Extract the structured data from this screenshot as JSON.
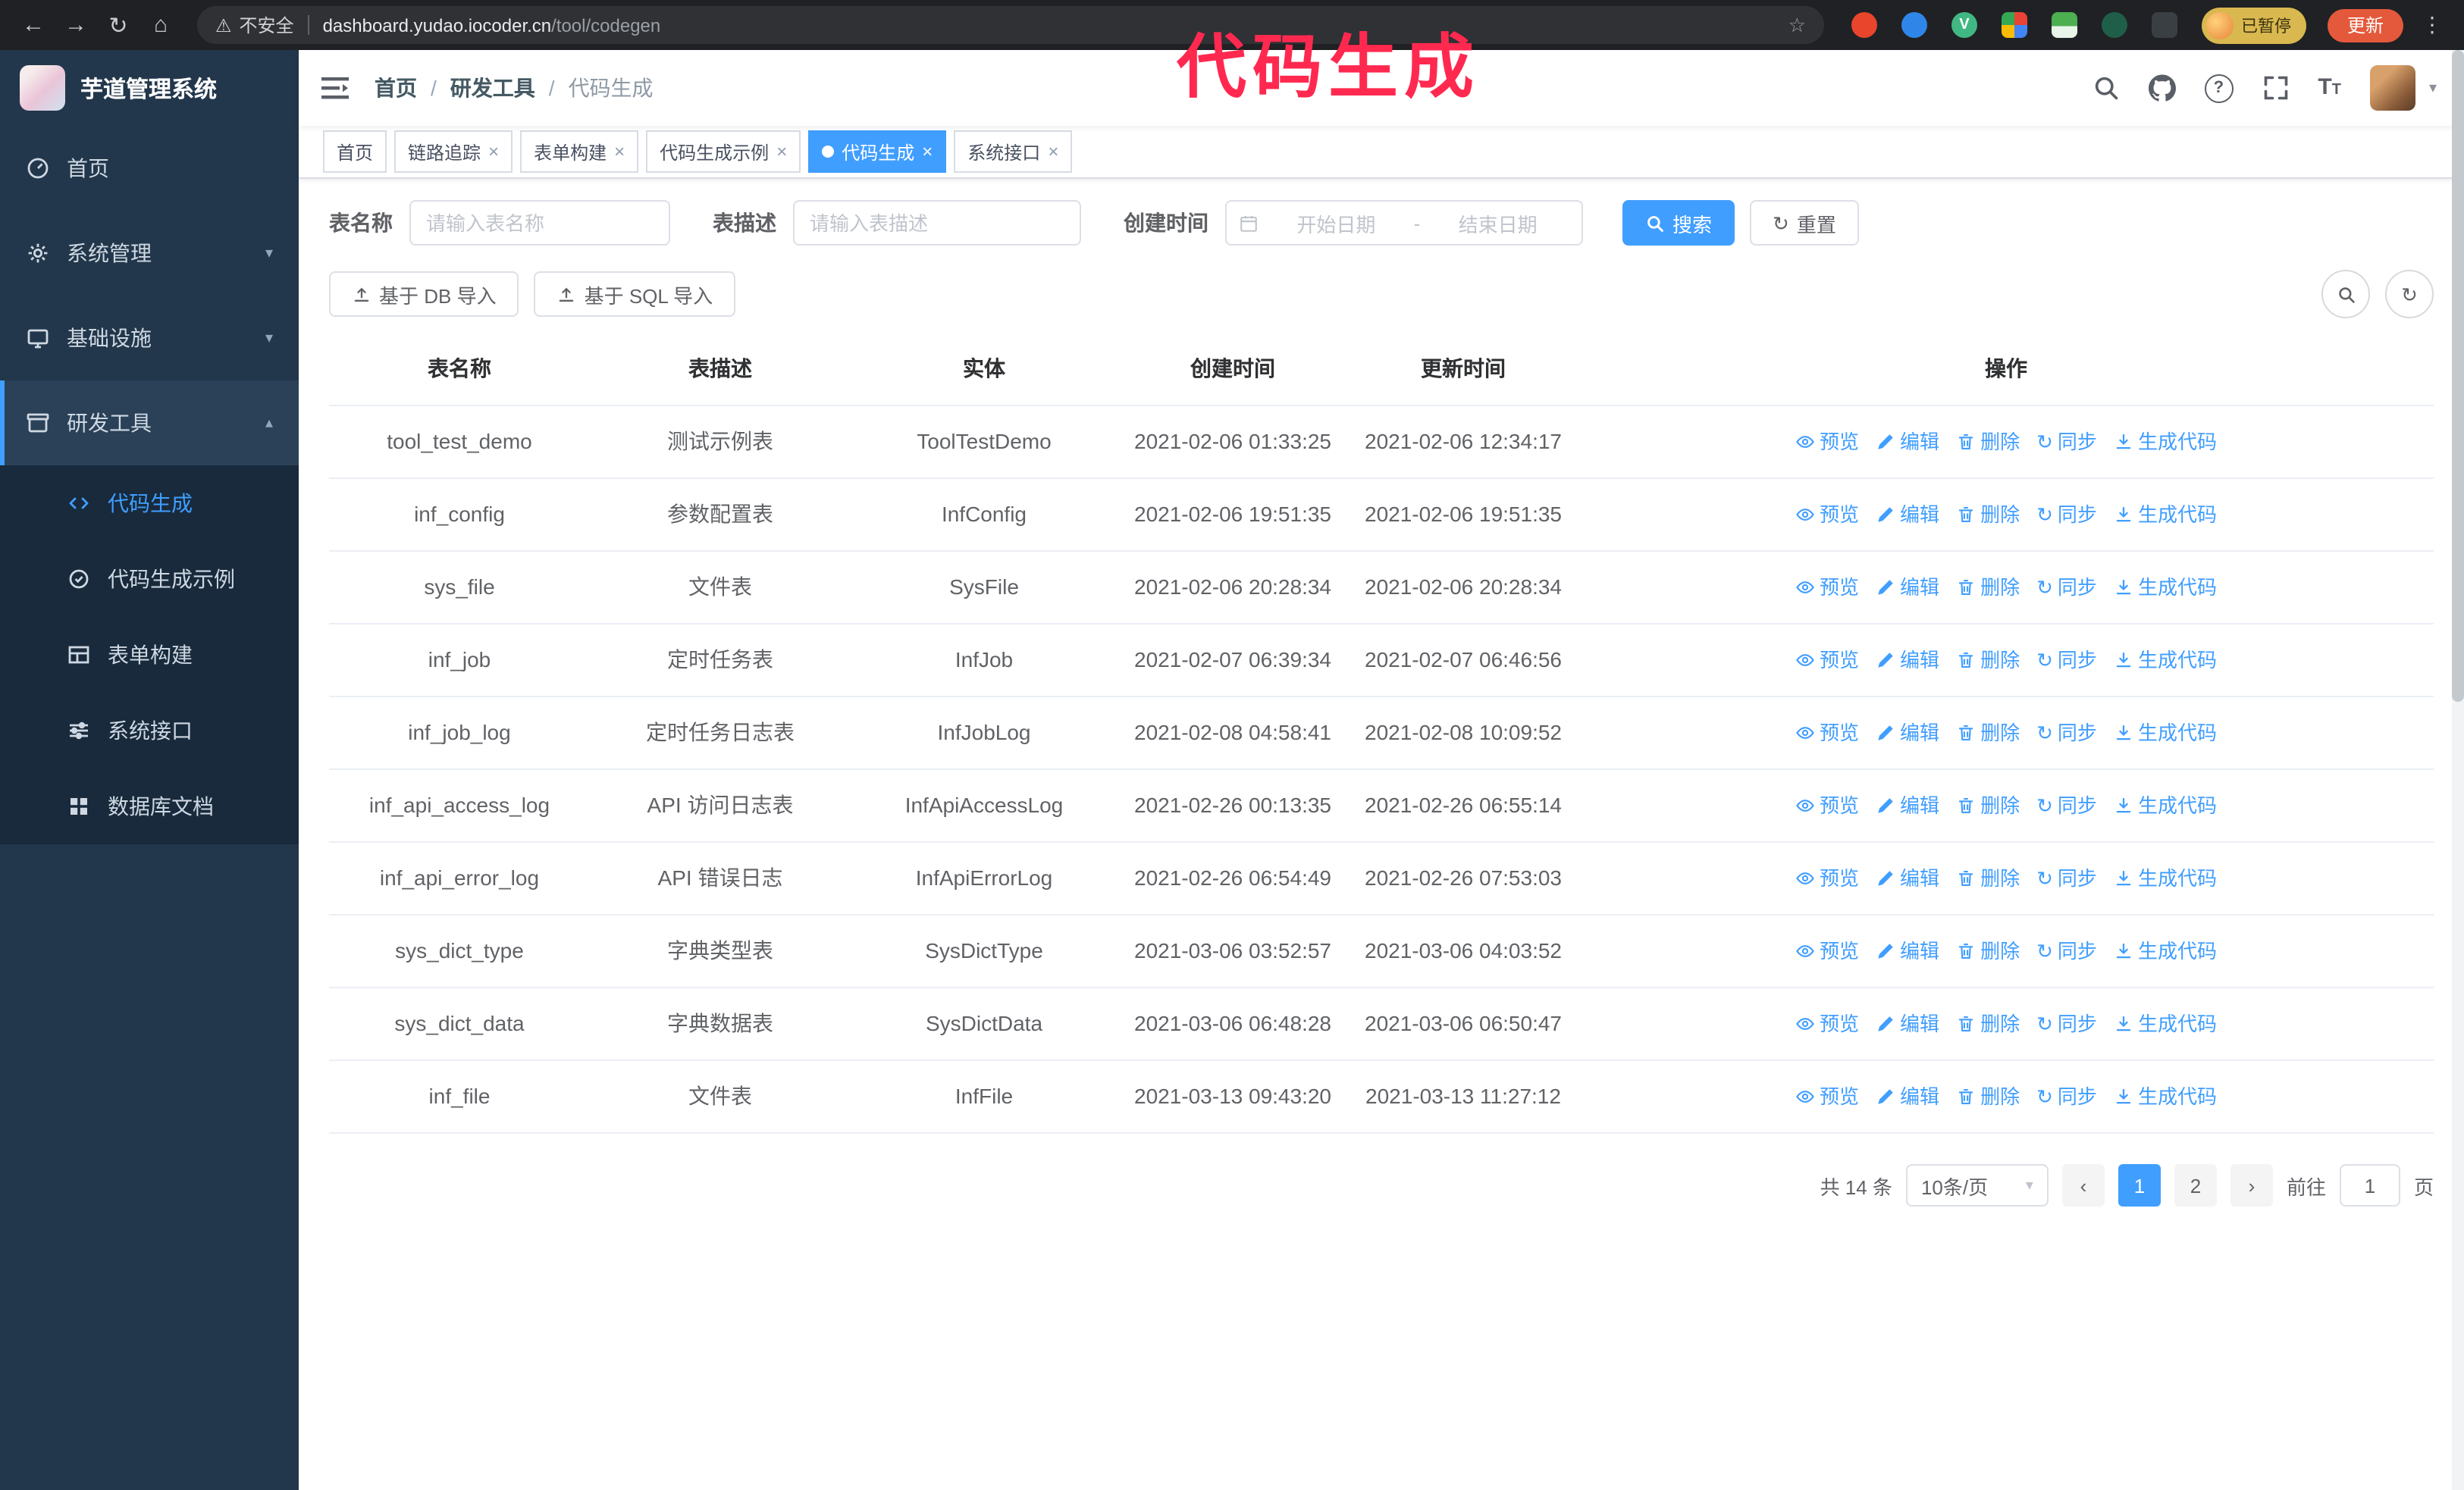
{
  "annotation": {
    "text": "代码生成",
    "color": "#ff2950"
  },
  "glyphs": {
    "back": "←",
    "forward": "→",
    "reload": "↻",
    "home": "⌂",
    "warning": "⚠",
    "star": "☆",
    "more": "⋮",
    "vue": "V",
    "close": "×",
    "chevron_down": "▾",
    "chevron_up": "▴",
    "caret": "▾",
    "separator": "/",
    "prev": "‹",
    "next": "›",
    "question": "?",
    "sync": "↻",
    "font_big": "T",
    "font_small": "T",
    "date_sep": "-"
  },
  "colors": {
    "accent": "#409eff",
    "sidebar_bg": "#22374b",
    "annotation": "#ff2950",
    "update_button": "#e4593b",
    "active_tab": "#409eff"
  },
  "browser": {
    "security": "不安全",
    "url_host": "dashboard.yudao.iocoder.cn",
    "url_path": "/tool/codegen",
    "paused": "已暂停",
    "update": "更新"
  },
  "sidebar": {
    "title": "芋道管理系统",
    "items": [
      {
        "label": "首页"
      },
      {
        "label": "系统管理"
      },
      {
        "label": "基础设施"
      },
      {
        "label": "研发工具"
      }
    ],
    "subitems": [
      {
        "label": "代码生成"
      },
      {
        "label": "代码生成示例"
      },
      {
        "label": "表单构建"
      },
      {
        "label": "系统接口"
      },
      {
        "label": "数据库文档"
      }
    ]
  },
  "header": {
    "breadcrumb": [
      "首页",
      "研发工具",
      "代码生成"
    ]
  },
  "tabs": [
    {
      "label": "首页"
    },
    {
      "label": "链路追踪"
    },
    {
      "label": "表单构建"
    },
    {
      "label": "代码生成示例"
    },
    {
      "label": "代码生成"
    },
    {
      "label": "系统接口"
    }
  ],
  "filters": {
    "name_label": "表名称",
    "name_placeholder": "请输入表名称",
    "desc_label": "表描述",
    "desc_placeholder": "请输入表描述",
    "time_label": "创建时间",
    "start_placeholder": "开始日期",
    "end_placeholder": "结束日期",
    "search": "搜索",
    "reset": "重置"
  },
  "toolbar": {
    "import_db": "基于 DB 导入",
    "import_sql": "基于 SQL 导入"
  },
  "table": {
    "columns": [
      "表名称",
      "表描述",
      "实体",
      "创建时间",
      "更新时间",
      "操作"
    ],
    "actions": [
      "预览",
      "编辑",
      "删除",
      "同步",
      "生成代码"
    ],
    "rows": [
      {
        "name": "tool_test_demo",
        "desc": "测试示例表",
        "entity": "ToolTestDemo",
        "created": "2021-02-06 01:33:25",
        "updated": "2021-02-06 12:34:17",
        "created_one_line": true,
        "updated_one_line": true
      },
      {
        "name": "inf_config",
        "desc": "参数配置表",
        "entity": "InfConfig",
        "created": "2021-02-06 19:51:35",
        "updated": "2021-02-06 19:51:35",
        "created_one_line": true,
        "updated_one_line": true
      },
      {
        "name": "sys_file",
        "desc": "文件表",
        "entity": "SysFile",
        "created": "2021-02-06 20:28:34",
        "updated": "2021-02-06 20:28:34"
      },
      {
        "name": "inf_job",
        "desc": "定时任务表",
        "entity": "InfJob",
        "created": "2021-02-07 06:39:34",
        "updated": "2021-02-07 06:46:56"
      },
      {
        "name": "inf_job_log",
        "desc": "定时任务日志表",
        "entity": "InfJobLog",
        "created": "2021-02-08 04:58:41",
        "updated": "2021-02-08 10:09:52"
      },
      {
        "name": "inf_api_access_log",
        "desc": "API 访问日志表",
        "entity": "InfApiAccessLog",
        "created": "2021-02-26 00:13:35",
        "updated": "2021-02-26 06:55:14",
        "created_one_line": true
      },
      {
        "name": "inf_api_error_log",
        "desc": "API 错误日志",
        "entity": "InfApiErrorLog",
        "created": "2021-02-26 06:54:49",
        "updated": "2021-02-26 07:53:03"
      },
      {
        "name": "sys_dict_type",
        "desc": "字典类型表",
        "entity": "SysDictType",
        "created": "2021-03-06 03:52:57",
        "updated": "2021-03-06 04:03:52"
      },
      {
        "name": "sys_dict_data",
        "desc": "字典数据表",
        "entity": "SysDictData",
        "created": "2021-03-06 06:48:28",
        "updated": "2021-03-06 06:50:47"
      },
      {
        "name": "inf_file",
        "desc": "文件表",
        "entity": "InfFile",
        "created": "2021-03-13 09:43:20",
        "updated": "2021-03-13 11:27:12",
        "updated_one_line": true
      }
    ]
  },
  "pagination": {
    "total": "共 14 条",
    "page_size": "10条/页",
    "pages": [
      "1",
      "2"
    ],
    "goto_label": "前往",
    "goto_value": "1",
    "unit_label": "页"
  }
}
